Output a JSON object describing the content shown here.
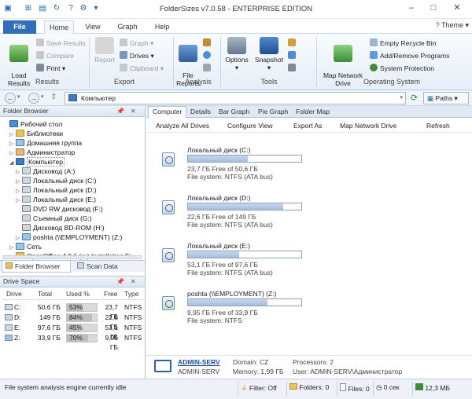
{
  "window": {
    "title": "FolderSizes v7.0.58 - ENTERPRISE EDITION",
    "minimize": "–",
    "maximize": "□",
    "close": "✕"
  },
  "ribbon_tabs": [
    "File",
    "Home",
    "View",
    "Graph",
    "Help"
  ],
  "ribbon": {
    "results": {
      "load": "Load\nResults",
      "save": "Save Results",
      "compare": "Compare",
      "print": "Print",
      "label": "Results"
    },
    "export": {
      "report": "Report",
      "graph": "Graph",
      "drives": "Drives",
      "clipboard": "Clipboard",
      "label": "Export"
    },
    "analysis": {
      "file_reports": "File\nReports",
      "label": "Analysis"
    },
    "tools": {
      "options": "Options",
      "snapshot": "Snapshot",
      "label": "Tools"
    },
    "system": {
      "map_network_drive": "Map Network\nDrive",
      "empty_recycle_bin": "Empty Recycle Bin",
      "add_remove_programs": "Add/Remove Programs",
      "system_protection": "System Protection",
      "label": "Operating System"
    },
    "theme": "Theme"
  },
  "address": {
    "path": "Компьютер",
    "paths_button": "Paths"
  },
  "folder_browser": {
    "title": "Folder Browser",
    "tree": [
      {
        "label": "Рабочий стол",
        "icon": "desktop-icon"
      },
      {
        "label": "Библиотеки",
        "icon": "folder-icon"
      },
      {
        "label": "Домашняя группа",
        "icon": "homegroup-icon"
      },
      {
        "label": "Администратор",
        "icon": "user-folder-icon"
      },
      {
        "label": "Компьютер",
        "icon": "computer-icon"
      },
      {
        "label": "Дисковод (A:)",
        "icon": "floppy-icon"
      },
      {
        "label": "Локальный диск (C:)",
        "icon": "drive-icon"
      },
      {
        "label": "Локальный диск (D:)",
        "icon": "drive-icon"
      },
      {
        "label": "Локальный диск (E:)",
        "icon": "drive-icon"
      },
      {
        "label": "DVD RW дисковод (F:)",
        "icon": "dvd-icon"
      },
      {
        "label": "Съемный диск (G:)",
        "icon": "removable-drive-icon"
      },
      {
        "label": "Дисковод BD-ROM (H:)",
        "icon": "bdrom-icon"
      },
      {
        "label": "poshta (\\\\EMPLOYMENT) (Z:)",
        "icon": "network-drive-icon"
      },
      {
        "label": "Сеть",
        "icon": "network-icon"
      },
      {
        "label": "OpenOffice 4.0.1 (ru) Installation Fi",
        "icon": "folder-icon"
      }
    ],
    "tabs": [
      "Folder Browser",
      "Scan Data"
    ]
  },
  "drive_space": {
    "title": "Drive Space",
    "columns": [
      "Drive",
      "Total",
      "Used %",
      "Free",
      "Type"
    ],
    "rows": [
      {
        "drive": "C:",
        "total": "50,6 ГБ",
        "used": "53%",
        "used_frac": 0.53,
        "free": "23,7 ГБ",
        "type": "NTFS"
      },
      {
        "drive": "D:",
        "total": "149 ГБ",
        "used": "84%",
        "used_frac": 0.84,
        "free": "22,6 ГБ",
        "type": "NTFS"
      },
      {
        "drive": "E:",
        "total": "97,6 ГБ",
        "used": "45%",
        "used_frac": 0.45,
        "free": "53,1 ГБ",
        "type": "NTFS"
      },
      {
        "drive": "Z:",
        "total": "33,9 ГБ",
        "used": "70%",
        "used_frac": 0.7,
        "free": "9,95 ГБ",
        "type": "NTFS"
      }
    ]
  },
  "main_tabs": [
    "Computer",
    "Details",
    "Bar Graph",
    "Pie Graph",
    "Folder Map"
  ],
  "toolbar": {
    "analyze": "Analyze All Drives",
    "configure": "Configure View",
    "export": "Export As",
    "map": "Map Network Drive",
    "refresh": "Refresh"
  },
  "drives": [
    {
      "name": "Локальный диск (C:)",
      "used_frac": 0.53,
      "free": "23,7 ГБ Free of 50,6 ГБ",
      "fs": "File system: NTFS (ATA bus)"
    },
    {
      "name": "Локальный диск (D:)",
      "used_frac": 0.84,
      "free": "22,6 ГБ Free of 149 ГБ",
      "fs": "File system: NTFS (ATA bus)"
    },
    {
      "name": "Локальный диск (E:)",
      "used_frac": 0.45,
      "free": "53,1 ГБ Free of 97,6 ГБ",
      "fs": "File system: NTFS (ATA bus)"
    },
    {
      "name": "poshta (\\\\EMPLOYMENT) (Z:)",
      "used_frac": 0.7,
      "free": "9,95 ГБ Free of 33,9 ГБ",
      "fs": "File system: NTFS"
    }
  ],
  "system_info": {
    "host": "ADMIN-SERV",
    "host2": "ADMIN-SERV",
    "domain": "Domain: CZ",
    "memory": "Memory: 1,99 ГБ",
    "processors": "Processors: 2",
    "user": "User: ADMIN-SERV\\Администратор"
  },
  "status": {
    "message": "File system analysis engine currently idle",
    "filter": "Filter: Off",
    "folders": "Folders: 0",
    "files": "Files: 0",
    "time": "0 сек",
    "memory": "12,3 МБ"
  }
}
